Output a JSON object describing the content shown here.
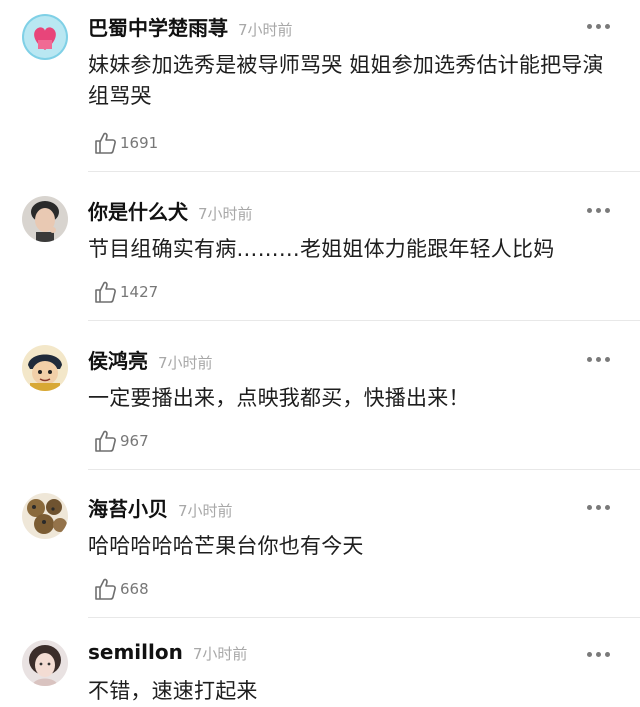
{
  "comments": [
    {
      "username": "巴蜀中学楚雨荨",
      "time": "7小时前",
      "text": "妹妹参加选秀是被导师骂哭  姐姐参加选秀估计能把导演组骂哭",
      "likes": "1691",
      "avatar_icon": "pink-heart-avatar"
    },
    {
      "username": "你是什么犬",
      "time": "7小时前",
      "text": "节目组确实有病………老姐姐体力能跟年轻人比妈",
      "likes": "1427",
      "avatar_icon": "man-photo-avatar"
    },
    {
      "username": "侯鸿亮",
      "time": "7小时前",
      "text": "一定要播出来，点映我都买，快播出来！",
      "likes": "967",
      "avatar_icon": "cartoon-character-avatar"
    },
    {
      "username": "海苔小贝",
      "time": "7小时前",
      "text": "哈哈哈哈哈芒果台你也有今天",
      "likes": "668",
      "avatar_icon": "cookies-avatar"
    },
    {
      "username": "semillon",
      "time": "7小时前",
      "text": "不错，速速打起来",
      "likes": "",
      "avatar_icon": "girl-photo-avatar"
    }
  ]
}
